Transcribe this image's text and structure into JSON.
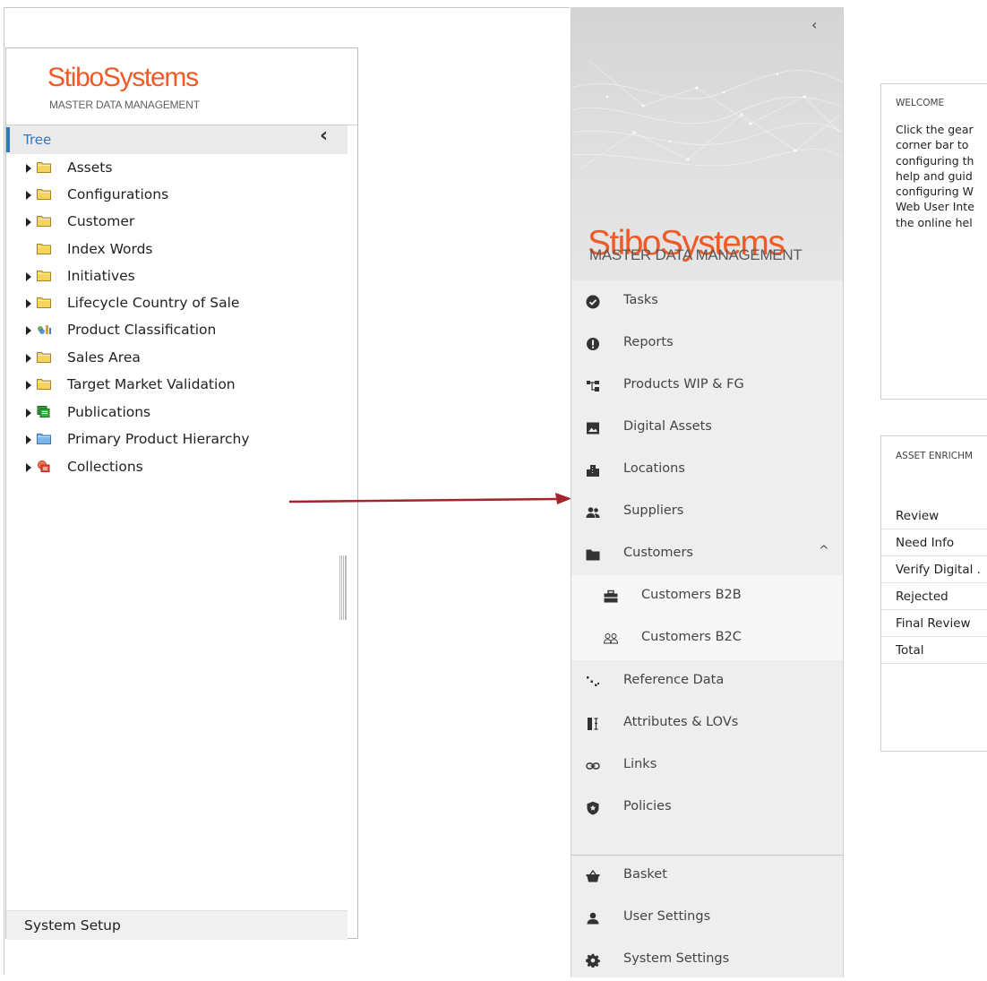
{
  "left_panel": {
    "logo": {
      "brand": "StiboSystems",
      "tagline": "MASTER DATA MANAGEMENT"
    },
    "tree_title": "Tree",
    "collapse_glyph": "‹",
    "tree_items": [
      {
        "label": "Assets",
        "expandable": true,
        "icon": "folder-icon"
      },
      {
        "label": "Configurations",
        "expandable": true,
        "icon": "folder-icon"
      },
      {
        "label": "Customer",
        "expandable": true,
        "icon": "folder-icon"
      },
      {
        "label": "Index Words",
        "expandable": false,
        "icon": "folder-icon"
      },
      {
        "label": "Initiatives",
        "expandable": true,
        "icon": "folder-icon"
      },
      {
        "label": "Lifecycle Country of Sale",
        "expandable": true,
        "icon": "folder-icon"
      },
      {
        "label": "Product Classification",
        "expandable": true,
        "icon": "product-classification-icon"
      },
      {
        "label": "Sales Area",
        "expandable": true,
        "icon": "folder-icon"
      },
      {
        "label": "Target Market Validation",
        "expandable": true,
        "icon": "folder-icon"
      },
      {
        "label": "Publications",
        "expandable": true,
        "icon": "publications-icon"
      },
      {
        "label": "Primary Product Hierarchy",
        "expandable": true,
        "icon": "blue-folder-icon"
      },
      {
        "label": "Collections",
        "expandable": true,
        "icon": "collections-icon"
      }
    ],
    "footer": "System Setup"
  },
  "nav": {
    "collapse_glyph": "‹",
    "logo": {
      "brand": "StiboSystems",
      "tagline": "MASTER DATA MANAGEMENT"
    },
    "items": [
      {
        "label": "Tasks",
        "icon": "check-circle-icon"
      },
      {
        "label": "Reports",
        "icon": "exclamation-circle-icon"
      },
      {
        "label": "Products WIP & FG",
        "icon": "hierarchy-icon"
      },
      {
        "label": "Digital Assets",
        "icon": "image-icon"
      },
      {
        "label": "Locations",
        "icon": "building-icon"
      },
      {
        "label": "Suppliers",
        "icon": "users-icon"
      },
      {
        "label": "Customers",
        "icon": "folder-solid-icon",
        "expanded": true,
        "chevron": "^"
      }
    ],
    "sub_items": [
      {
        "label": "Customers B2B",
        "icon": "briefcase-icon"
      },
      {
        "label": "Customers B2C",
        "icon": "user-group-icon"
      }
    ],
    "items_after": [
      {
        "label": "Reference Data",
        "icon": "scatter-icon"
      },
      {
        "label": "Attributes & LOVs",
        "icon": "attribute-icon"
      },
      {
        "label": "Links",
        "icon": "link-icon"
      },
      {
        "label": "Policies",
        "icon": "shield-icon"
      }
    ],
    "bottom_items": [
      {
        "label": "Basket",
        "icon": "basket-icon"
      },
      {
        "label": "User Settings",
        "icon": "user-icon"
      },
      {
        "label": "System Settings",
        "icon": "gear-icon"
      }
    ]
  },
  "cards": {
    "welcome": {
      "title": "WELCOME",
      "lines": [
        "Click the gear",
        "corner bar to",
        "configuring th",
        "help and guid",
        "configuring W",
        "Web User Inte",
        "the online hel"
      ]
    },
    "asset": {
      "title": "ASSET ENRICHM",
      "rows": [
        "Review",
        "Need Info",
        "Verify Digital .",
        "Rejected",
        "Final Review",
        "Total"
      ]
    }
  },
  "colors": {
    "brand_orange": "#ef5a26",
    "tree_accent_blue": "#2f78c4",
    "arrow_red": "#a4232d"
  }
}
